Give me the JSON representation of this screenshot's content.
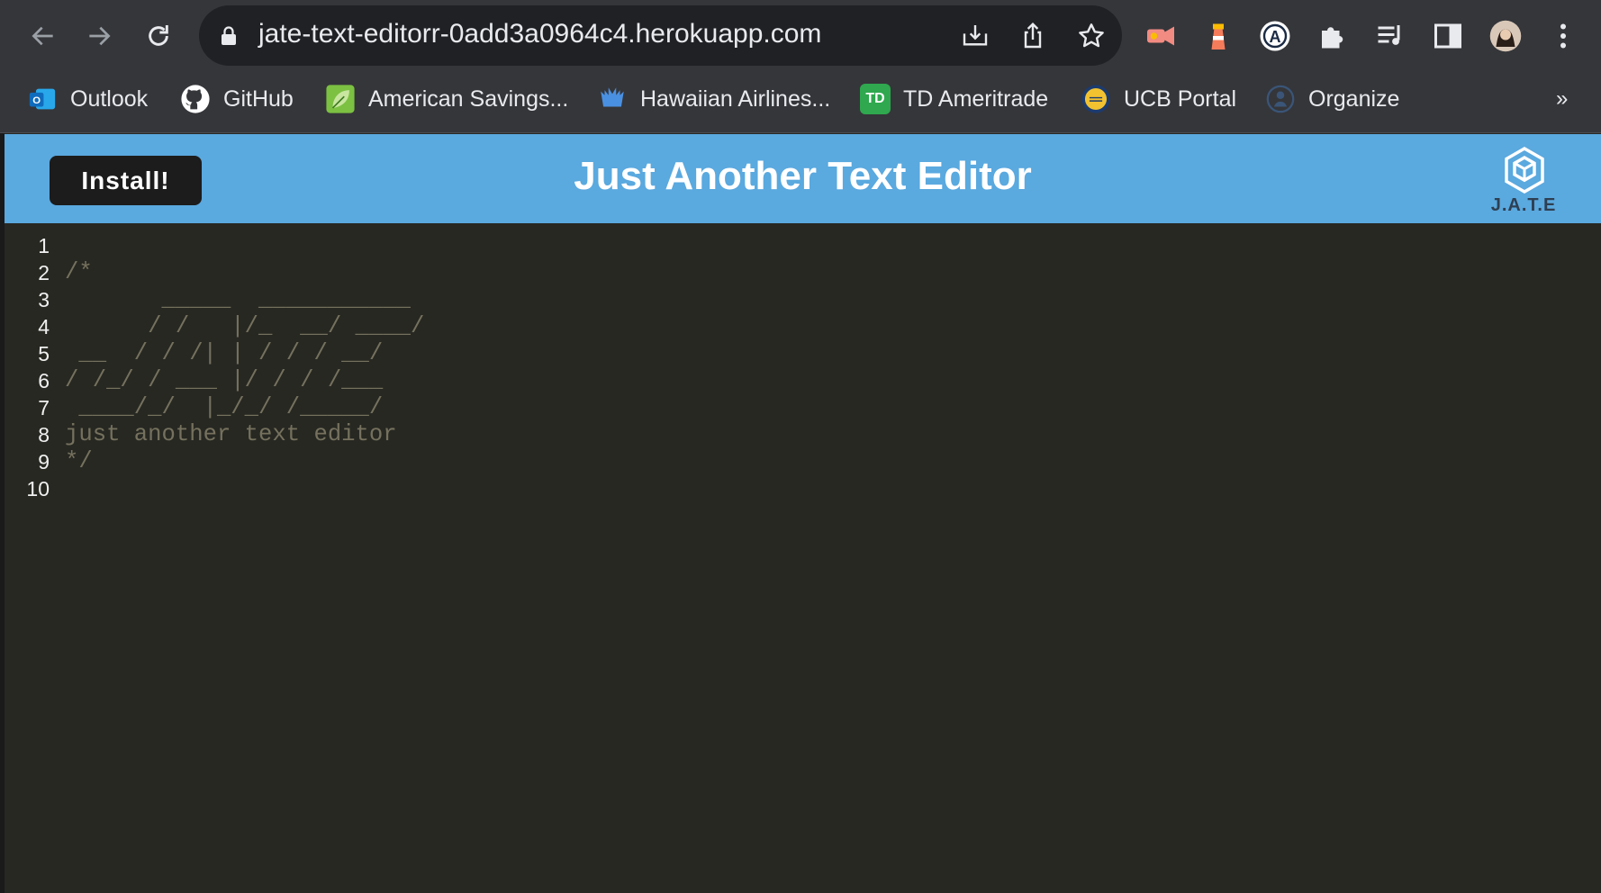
{
  "browser": {
    "url": "jate-text-editorr-0add3a0964c4.herokuapp.com",
    "bookmarks": [
      {
        "label": "Outlook",
        "icon": "outlook-icon"
      },
      {
        "label": "GitHub",
        "icon": "github-icon"
      },
      {
        "label": "American Savings...",
        "icon": "leaf-icon"
      },
      {
        "label": "Hawaiian Airlines...",
        "icon": "bank-icon"
      },
      {
        "label": "TD Ameritrade",
        "icon": "td-icon"
      },
      {
        "label": "UCB Portal",
        "icon": "ucb-icon"
      },
      {
        "label": "Organize",
        "icon": "organize-icon"
      }
    ],
    "overflow": "»",
    "td_badge": "TD"
  },
  "app": {
    "install_label": "Install!",
    "title": "Just Another Text Editor",
    "logo_text": "J.A.T.E",
    "header_color": "#5aa9df"
  },
  "editor": {
    "line_numbers": [
      "1",
      "2",
      "3",
      "4",
      "5",
      "6",
      "7",
      "8",
      "9",
      "10"
    ],
    "lines": [
      "",
      "/*",
      "       _____  ___________",
      "      / /   |/_  __/ ____/",
      " __  / / /| | / / / __/",
      "/ /_/ / ___ |/ / / /___",
      " ____/_/  |_/_/ /_____/",
      "just another text editor",
      "*/",
      ""
    ]
  }
}
